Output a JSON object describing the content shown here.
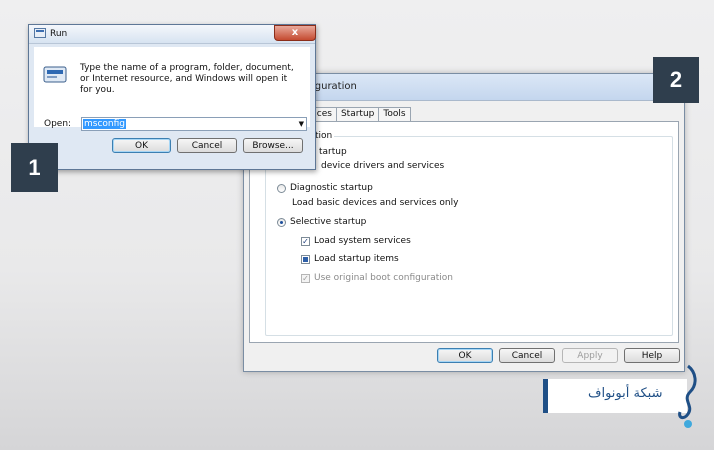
{
  "run_dialog": {
    "title": "Run",
    "description": "Type the name of a program, folder, document, or Internet resource, and Windows will open it for you.",
    "open_label": "Open:",
    "input_value": "msconfig",
    "ok_label": "OK",
    "cancel_label": "Cancel",
    "browse_label": "Browse...",
    "close_glyph": "x"
  },
  "msconfig_window": {
    "title": "onfiguration",
    "tabs": [
      "Services",
      "Startup",
      "Tools"
    ],
    "group_label": "ction",
    "options": {
      "normal_title": "tartup",
      "normal_desc": "device drivers and services",
      "diagnostic_title": "Diagnostic startup",
      "diagnostic_desc": "Load basic devices and services only",
      "selective_title": "Selective startup"
    },
    "checks": {
      "system_services": "Load system services",
      "startup_items": "Load startup items",
      "original_boot": "Use original boot configuration"
    },
    "buttons": {
      "ok": "OK",
      "cancel": "Cancel",
      "apply": "Apply",
      "help": "Help"
    }
  },
  "badges": {
    "one": "1",
    "two": "2"
  },
  "watermark": {
    "text": "شبكة أبونواف"
  },
  "colors": {
    "badge": "#2f3e4d",
    "brand": "#1f4f86",
    "selection": "#3399ff"
  }
}
